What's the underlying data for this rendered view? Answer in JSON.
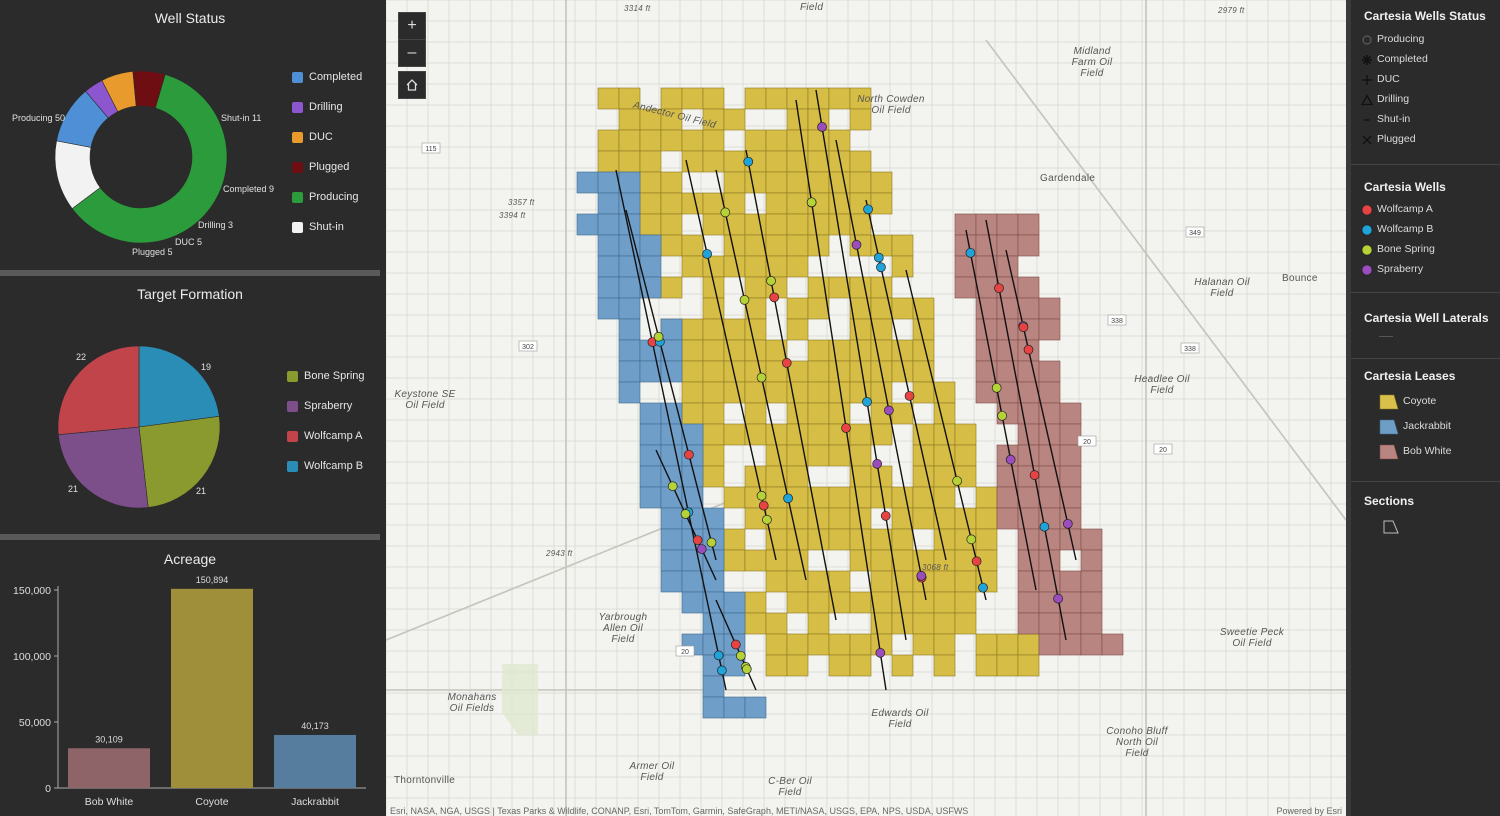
{
  "well_status": {
    "title": "Well Status",
    "legend": [
      {
        "label": "Completed",
        "color": "#4e8fd6"
      },
      {
        "label": "Drilling",
        "color": "#8c56cf"
      },
      {
        "label": "DUC",
        "color": "#e99a2c"
      },
      {
        "label": "Plugged",
        "color": "#6e0e13"
      },
      {
        "label": "Producing",
        "color": "#2b9b3c"
      },
      {
        "label": "Shut-in",
        "color": "#f2f2f2"
      }
    ],
    "slice_labels": [
      "Producing 50",
      "Shut-in 11",
      "Completed 9",
      "Drilling 3",
      "DUC 5",
      "Plugged 5"
    ]
  },
  "target_formation": {
    "title": "Target Formation",
    "legend": [
      {
        "label": "Bone Spring",
        "color": "#8b9a2e"
      },
      {
        "label": "Spraberry",
        "color": "#7d4f8a"
      },
      {
        "label": "Wolfcamp A",
        "color": "#c0444a"
      },
      {
        "label": "Wolfcamp B",
        "color": "#2a8db5"
      }
    ],
    "slice_labels": [
      "22",
      "19",
      "21",
      "21"
    ]
  },
  "acreage": {
    "title": "Acreage",
    "y_ticks": [
      "150,000",
      "100,000",
      "50,000",
      "0"
    ]
  },
  "chart_data": [
    {
      "type": "pie",
      "title": "Well Status",
      "categories": [
        "Producing",
        "Shut-in",
        "Completed",
        "Drilling",
        "DUC",
        "Plugged"
      ],
      "values": [
        50,
        11,
        9,
        3,
        5,
        5
      ],
      "colors": [
        "#2b9b3c",
        "#f2f2f2",
        "#4e8fd6",
        "#8c56cf",
        "#e99a2c",
        "#6e0e13"
      ]
    },
    {
      "type": "pie",
      "title": "Target Formation",
      "categories": [
        "Wolfcamp B",
        "Bone Spring",
        "Spraberry",
        "Wolfcamp A"
      ],
      "values": [
        19,
        21,
        21,
        22
      ],
      "colors": [
        "#2a8db5",
        "#8b9a2e",
        "#7d4f8a",
        "#c0444a"
      ]
    },
    {
      "type": "bar",
      "title": "Acreage",
      "categories": [
        "Bob White",
        "Coyote",
        "Jackrabbit"
      ],
      "values": [
        30109,
        150894,
        40173
      ],
      "value_labels": [
        "30,109",
        "150,894",
        "40,173"
      ],
      "colors": [
        "#8e6468",
        "#9f8e3a",
        "#577d9e"
      ],
      "ylim": [
        0,
        150000
      ]
    }
  ],
  "map": {
    "zoom_in": "+",
    "zoom_out": "–",
    "attribution": "Esri, NASA, NGA, USGS | Texas Parks & Wildlife, CONANP, Esri, TomTom, Garmin, SafeGraph, METI/NASA, USGS, EPA, NPS, USDA, USFWS",
    "powered": "Powered by Esri",
    "labels": [
      "Andector Oil Field",
      "North Cowden Oil Field",
      "Midland Farm Oil Field",
      "Gardendale",
      "Keystone SE Oil Field",
      "Halanan Oil Field",
      "Bounce",
      "Headlee Oil Field",
      "Yarbrough Allen Oil Field",
      "Monahans Oil Fields",
      "Edwards Oil Field",
      "Armer Oil Field",
      "C-Ber Oil Field",
      "Sweetie Peck Oil Field",
      "Conoho Bluff North Oil Field",
      "Thorntonville",
      "Field",
      "3314 ft",
      "2979 ft",
      "3357 ft",
      "3394 ft",
      "3068 ft",
      "2943 ft"
    ],
    "road_labels": [
      "115",
      "302",
      "349",
      "338",
      "338",
      "20",
      "20",
      "20"
    ]
  },
  "layers": {
    "wells_status": {
      "title": "Cartesia Wells Status",
      "items": [
        "Producing",
        "Completed",
        "DUC",
        "Drilling",
        "Shut-in",
        "Plugged"
      ]
    },
    "wells": {
      "title": "Cartesia Wells",
      "items": [
        {
          "label": "Wolfcamp A",
          "color": "#e84343"
        },
        {
          "label": "Wolfcamp B",
          "color": "#1fa3d8"
        },
        {
          "label": "Bone Spring",
          "color": "#b5d336"
        },
        {
          "label": "Spraberry",
          "color": "#9b4dbd"
        }
      ]
    },
    "laterals": {
      "title": "Cartesia Well Laterals"
    },
    "leases": {
      "title": "Cartesia Leases",
      "items": [
        {
          "label": "Coyote",
          "color": "#d8c04a"
        },
        {
          "label": "Jackrabbit",
          "color": "#6e9dc6"
        },
        {
          "label": "Bob White",
          "color": "#b98580"
        }
      ]
    },
    "sections": {
      "title": "Sections"
    }
  }
}
